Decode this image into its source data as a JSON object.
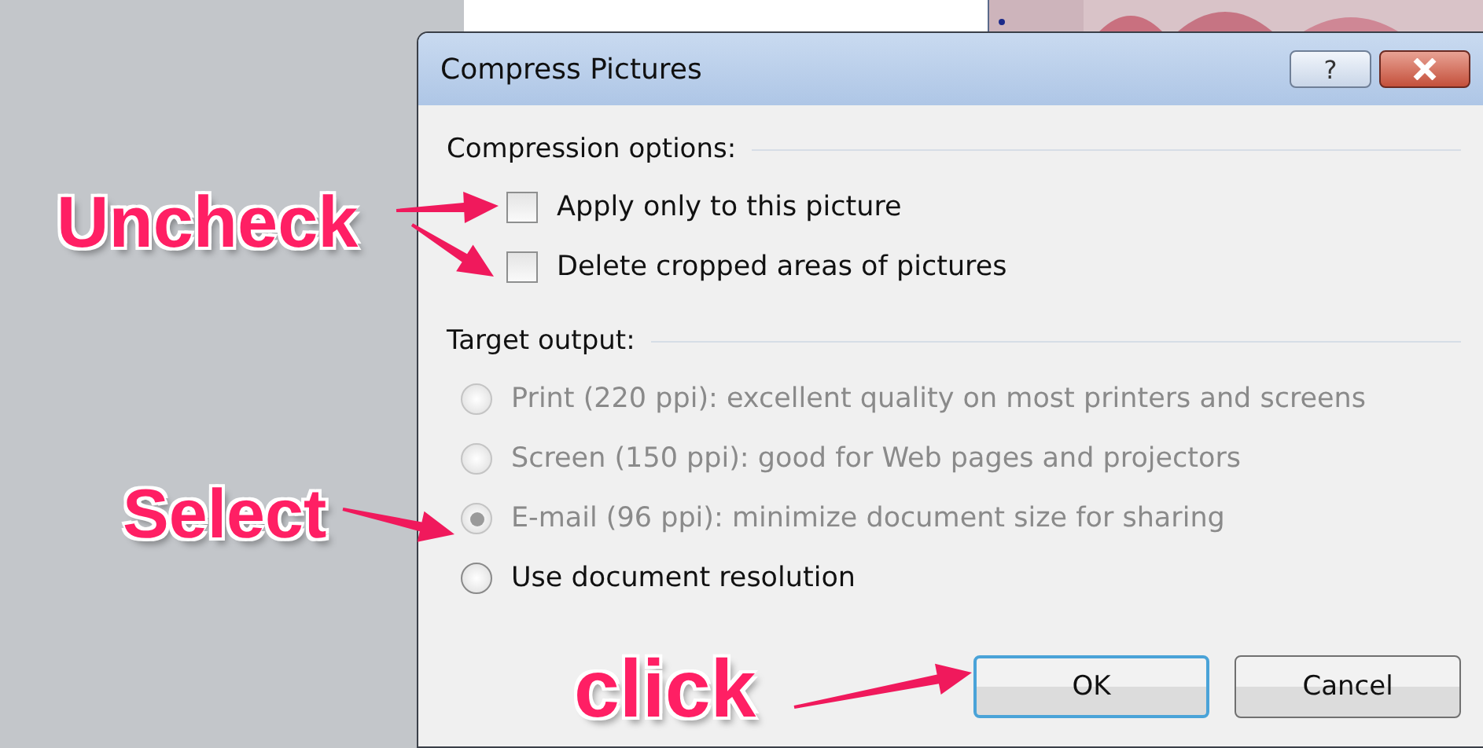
{
  "window": {
    "title": "Compress Pictures"
  },
  "help_button": {
    "label": "?"
  },
  "sections": [
    {
      "heading": "Compression options:",
      "options": [
        {
          "kind": "checkbox",
          "label": "Apply only to this picture",
          "checked": false
        },
        {
          "kind": "checkbox",
          "label": "Delete cropped areas of pictures",
          "checked": false
        }
      ]
    },
    {
      "heading": "Target output:",
      "options": [
        {
          "kind": "radio",
          "label": "Print (220 ppi): excellent quality on most printers and screens",
          "selected": false,
          "disabled": true
        },
        {
          "kind": "radio",
          "label": "Screen (150 ppi): good for Web pages and projectors",
          "selected": false,
          "disabled": true
        },
        {
          "kind": "radio",
          "label": "E-mail (96 ppi): minimize document size for sharing",
          "selected": true,
          "disabled": true
        },
        {
          "kind": "radio",
          "label": "Use document resolution",
          "selected": false,
          "disabled": false
        }
      ]
    }
  ],
  "buttons": [
    {
      "label": "OK",
      "default": true
    },
    {
      "label": "Cancel",
      "default": false
    }
  ],
  "annotations": [
    {
      "text": "Uncheck"
    },
    {
      "text": "Select"
    },
    {
      "text": "click"
    }
  ]
}
